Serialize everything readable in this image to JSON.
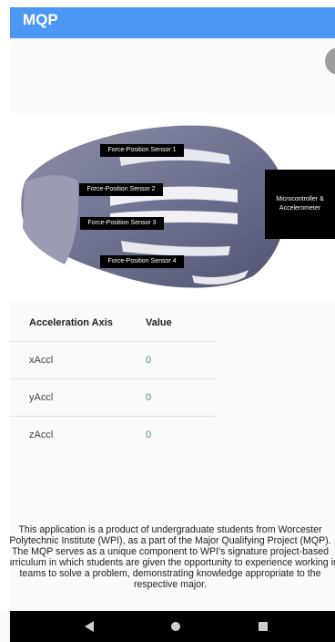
{
  "app_bar": {
    "title": "MQP"
  },
  "diagram": {
    "labels": {
      "sensor1": "Force-Position Sensor 1",
      "sensor2": "Force-Position Sensor 2",
      "sensor3": "Force-Position Sensor 3",
      "sensor4": "Force-Position Sensor 4",
      "microcontroller": "Microcontroller & Accelerometer"
    }
  },
  "table": {
    "headers": [
      "Acceleration Axis",
      "Value"
    ],
    "rows": [
      {
        "axis": "xAccl",
        "value": "0"
      },
      {
        "axis": "yAccl",
        "value": "0"
      },
      {
        "axis": "zAccl",
        "value": "0"
      }
    ]
  },
  "about": {
    "text": "This application is a product of undergraduate students from Worcester Polytechnic Institute (WPI), as a part of the Major Qualifying Project (MQP). The MQP serves as a unique component to WPI's signature project-based curriculum in which students are given the opportunity to experience working in teams to solve a problem, demonstrating knowledge appropriate to the respective major."
  },
  "nav": {
    "icons": [
      "back-icon",
      "home-icon",
      "recents-icon"
    ]
  },
  "colors": {
    "app_bar": "#4c97f2",
    "value_text": "#43a047",
    "nav_bar": "#000000"
  }
}
